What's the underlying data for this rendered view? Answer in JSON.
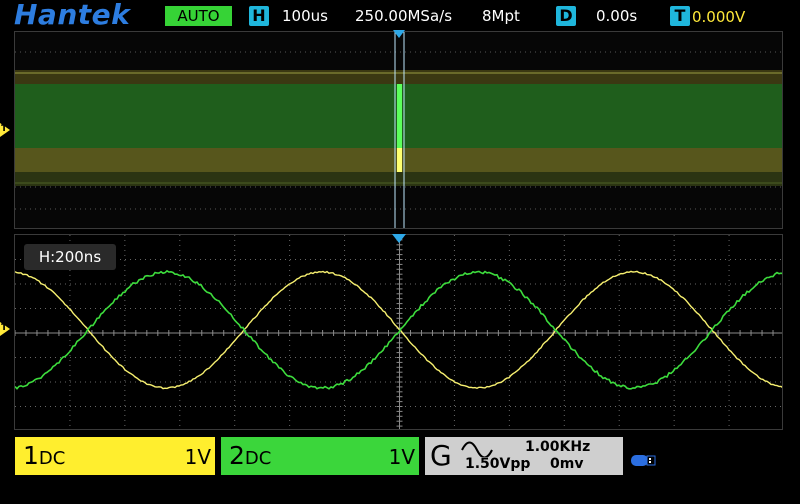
{
  "top": {
    "brand": "Hantek",
    "mode": "AUTO",
    "horizontal_badge": "H",
    "timebase": "100us",
    "sample_rate": "250.00MSa/s",
    "memory_depth": "8Mpt",
    "delay_badge": "D",
    "delay": "0.00s",
    "trigger_badge": "T",
    "trigger_level": "0.000V"
  },
  "zoom": {
    "label": "H:200ns"
  },
  "channels": [
    {
      "number": "1",
      "coupling": "DC",
      "scale": "1V",
      "color": "#ffee2e"
    },
    {
      "number": "2",
      "coupling": "DC",
      "scale": "1V",
      "color": "#3bd63b"
    }
  ],
  "generator": {
    "letter": "G",
    "waveform": "sine-wave-icon",
    "frequency": "1.00KHz",
    "amplitude": "1.50Vpp",
    "offset": "0mv"
  },
  "markers": {
    "overview_trigger": "T",
    "zoom_trigger": "T"
  },
  "icons": {
    "usb": "usb-icon"
  },
  "colors": {
    "ch1": "#ffee2e",
    "ch2": "#3bd63b",
    "brand": "#2d7de0",
    "badge": "#1fb6dc",
    "grid": "#6a6a6a"
  }
}
